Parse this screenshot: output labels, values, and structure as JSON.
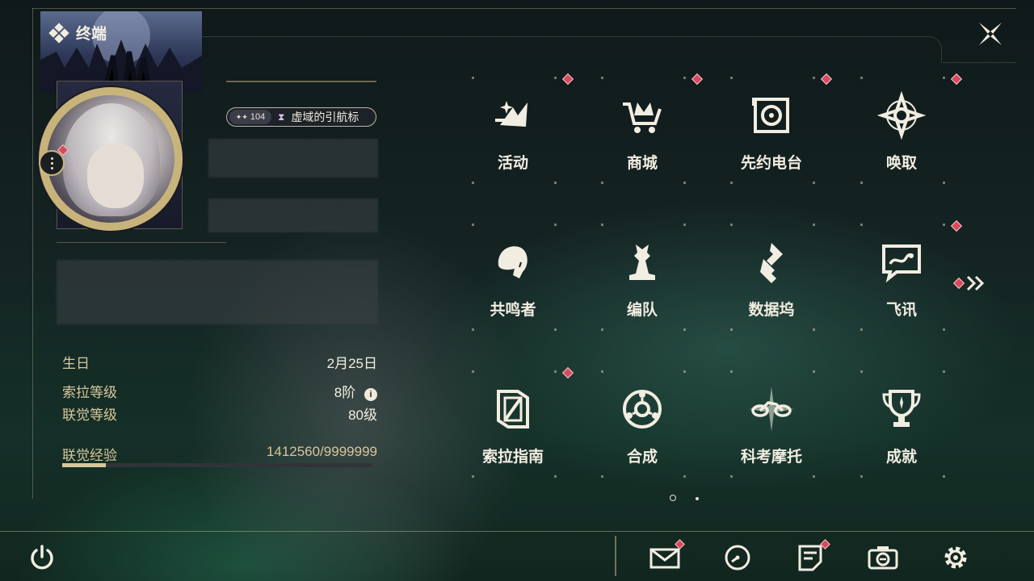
{
  "header": {
    "title": "终端"
  },
  "profile": {
    "level": "104",
    "title_badge": "虚域的引航标",
    "stats": [
      {
        "key": "生日",
        "value": "2月25日"
      },
      {
        "key": "索拉等级",
        "value": "8阶"
      },
      {
        "key": "联觉等级",
        "value": "80级"
      }
    ],
    "exp": {
      "label": "联觉经验",
      "value": "1412560/9999999",
      "fraction": 0.1412
    }
  },
  "grid": {
    "items": [
      {
        "label": "活动",
        "icon": "event-icon",
        "alert": true
      },
      {
        "label": "商城",
        "icon": "shop-icon",
        "alert": true
      },
      {
        "label": "先约电台",
        "icon": "radio-icon",
        "alert": true
      },
      {
        "label": "唤取",
        "icon": "convene-icon",
        "alert": true
      },
      {
        "label": "共鸣者",
        "icon": "resonator-icon",
        "alert": false
      },
      {
        "label": "编队",
        "icon": "team-icon",
        "alert": false
      },
      {
        "label": "数据坞",
        "icon": "databank-icon",
        "alert": false
      },
      {
        "label": "飞讯",
        "icon": "chat-icon",
        "alert": true
      },
      {
        "label": "索拉指南",
        "icon": "guidebook-icon",
        "alert": true
      },
      {
        "label": "合成",
        "icon": "synthesis-icon",
        "alert": false
      },
      {
        "label": "科考摩托",
        "icon": "motorbike-icon",
        "alert": false
      },
      {
        "label": "成就",
        "icon": "trophy-icon",
        "alert": false
      }
    ],
    "page_current": 1,
    "page_total": 2
  },
  "bottom_bar": {
    "buttons": [
      "power-icon",
      "mail-icon",
      "clock-icon",
      "notice-icon",
      "camera-icon",
      "settings-icon"
    ]
  },
  "colors": {
    "accent": "#d8c79a",
    "alert": "#d64a5a",
    "text": "#f2ede1"
  }
}
